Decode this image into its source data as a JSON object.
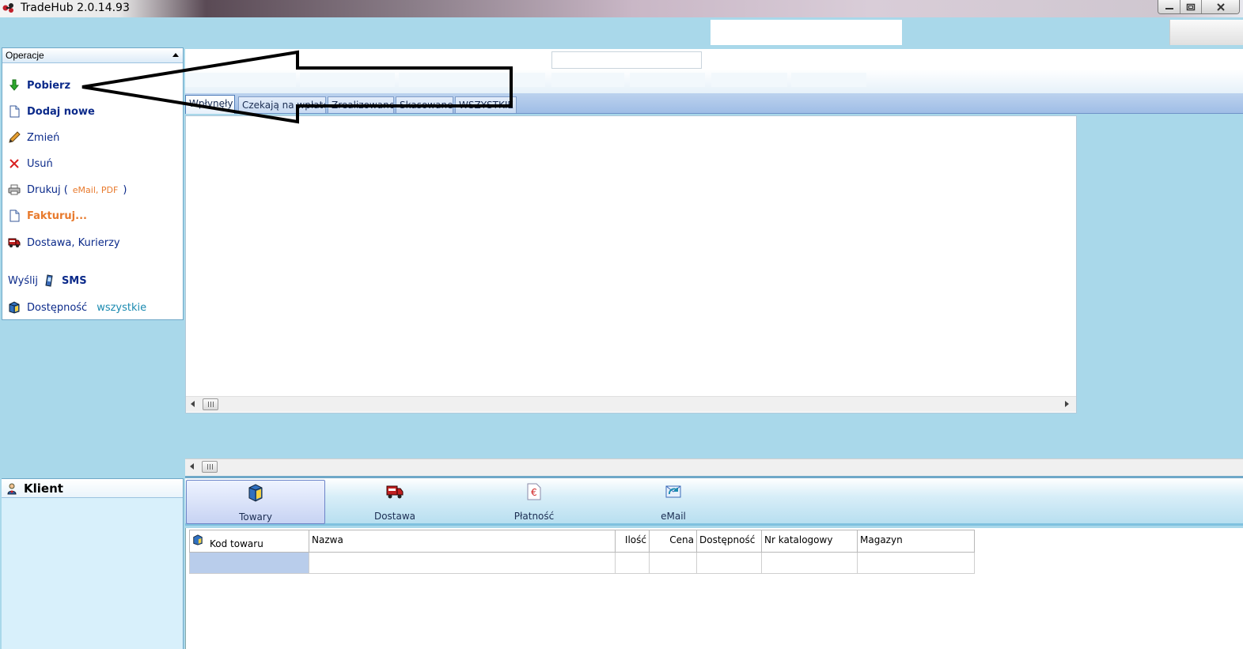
{
  "window": {
    "title": "TradeHub 2.0.14.93",
    "buttons": [
      "minimize-icon",
      "maximize-icon",
      "close-icon"
    ]
  },
  "operations": {
    "header": "Operacje",
    "items": [
      {
        "label": "Pobierz",
        "icon": "download-arrow-icon"
      },
      {
        "label": "Dodaj nowe",
        "icon": "new-document-icon"
      },
      {
        "label": "Zmień",
        "icon": "pencil-icon"
      },
      {
        "label": "Usuń",
        "icon": "delete-x-icon"
      },
      {
        "label": "Drukuj (",
        "extra": "eMail, PDF",
        "close": ")",
        "icon": "printer-icon"
      },
      {
        "label": "Fakturuj...",
        "icon": "invoice-document-icon"
      },
      {
        "label": "Dostawa, Kurierzy",
        "icon": "truck-icon"
      }
    ],
    "sms": {
      "prefix": "Wyślij",
      "label": "SMS",
      "icon": "phone-icon"
    },
    "availability": {
      "label": "Dostępność",
      "value": "wszystkie",
      "icon": "box-icon"
    }
  },
  "client": {
    "header": "Klient",
    "icon": "person-icon"
  },
  "order_tabs": [
    "Wpłynęły",
    "Czekają na wpłatę",
    "Zrealizowane",
    "Skasowane",
    "WSZYSTKIE"
  ],
  "tool_tabs": [
    {
      "label": "Towary",
      "icon": "box-icon",
      "active": true
    },
    {
      "label": "Dostawa",
      "icon": "truck-icon",
      "active": false
    },
    {
      "label": "Płatność",
      "icon": "euro-icon",
      "active": false
    },
    {
      "label": "eMail",
      "icon": "email-refresh-icon",
      "active": false
    }
  ],
  "items_grid": {
    "columns": [
      "Kod towaru",
      "Nazwa",
      "Ilość",
      "Cena",
      "Dostępność",
      "Nr katalogowy",
      "Magazyn"
    ]
  },
  "colors": {
    "background": "#a9d8ea",
    "link_blue": "#0b2a8a",
    "orange": "#e87a2d",
    "teal": "#1a8ab0",
    "annotation_arrow": "#000000"
  }
}
